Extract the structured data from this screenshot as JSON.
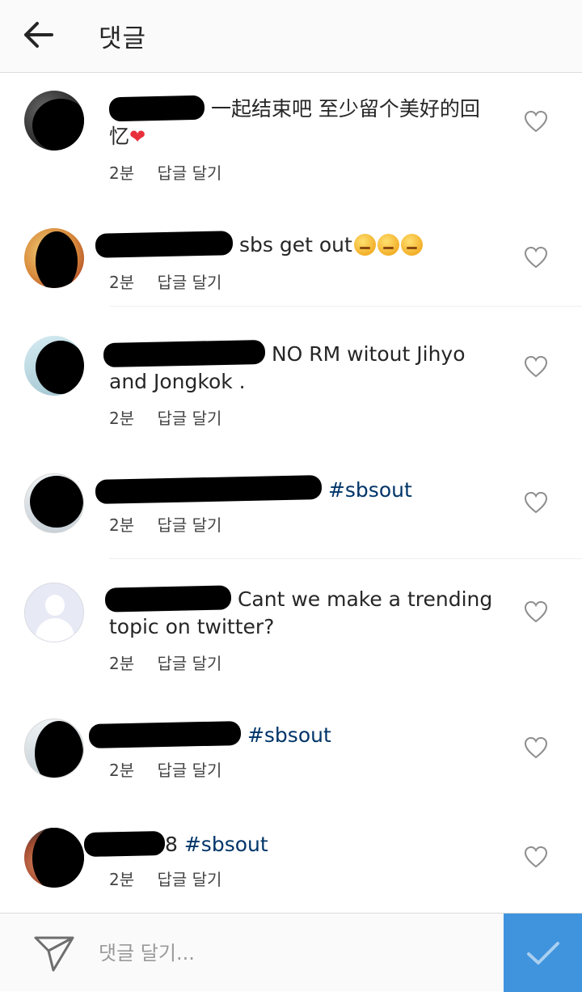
{
  "header": {
    "title": "댓글"
  },
  "comments": [
    {
      "text_line1": "一起结束吧 至少留个美好的回",
      "text_line2": "忆",
      "heart": "❤",
      "time": "2분",
      "reply": "답글 달기"
    },
    {
      "text": "sbs get out",
      "time": "2분",
      "reply": "답글 달기"
    },
    {
      "text_line1": "NO RM witout Jihyo",
      "text_line2": "and Jongkok .",
      "time": "2분",
      "reply": "답글 달기"
    },
    {
      "hashtag": "#sbsout",
      "time": "2분",
      "reply": "답글 달기"
    },
    {
      "text_line1": "Cant we make a trending",
      "text_line2": "topic on twitter?",
      "time": "2분",
      "reply": "답글 달기"
    },
    {
      "hashtag": "#sbsout",
      "time": "2분",
      "reply": "답글 달기"
    },
    {
      "prefix": "8",
      "hashtag": "#sbsout",
      "time": "2분",
      "reply": "답글 달기"
    }
  ],
  "footer": {
    "placeholder": "댓글 달기..."
  },
  "colors": {
    "accent": "#3f94dd",
    "hashtag": "#003569",
    "heart_emoji": "#e8303a"
  }
}
